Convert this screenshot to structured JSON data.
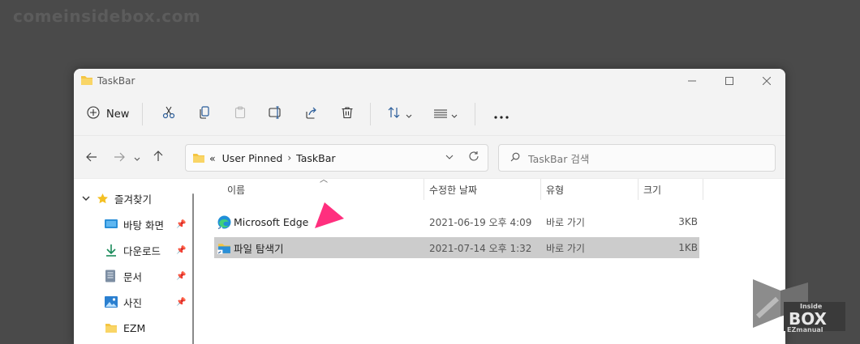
{
  "watermark": "comeinsidebox.com",
  "window": {
    "title": "TaskBar",
    "controls": {
      "minimize": "—",
      "maximize": "☐",
      "close": "✕"
    }
  },
  "toolbar": {
    "new_label": "New",
    "icons": [
      "cut-icon",
      "copy-icon",
      "paste-icon",
      "rename-icon",
      "share-icon",
      "delete-icon",
      "sort-icon",
      "view-icon",
      "more-icon"
    ]
  },
  "nav": {
    "back": "←",
    "forward": "→",
    "recent": "˅",
    "up": "↑",
    "address_prefix": "«",
    "breadcrumb": [
      "User Pinned",
      "TaskBar"
    ],
    "search_placeholder": "TaskBar 검색"
  },
  "sidebar": {
    "items": [
      {
        "label": "즐겨찾기",
        "icon": "star-icon",
        "pinned": false
      },
      {
        "label": "바탕 화면",
        "icon": "desktop-icon",
        "pinned": true
      },
      {
        "label": "다운로드",
        "icon": "download-icon",
        "pinned": true
      },
      {
        "label": "문서",
        "icon": "document-icon",
        "pinned": true
      },
      {
        "label": "사진",
        "icon": "pictures-icon",
        "pinned": true
      },
      {
        "label": "EZM",
        "icon": "folder-icon",
        "pinned": false
      }
    ]
  },
  "columns": {
    "name": "이름",
    "modified": "수정한 날짜",
    "type": "유형",
    "size": "크기"
  },
  "files": [
    {
      "name": "Microsoft Edge",
      "modified": "2021-06-19 오후 4:09",
      "type": "바로 가기",
      "size": "3KB",
      "icon": "edge-icon",
      "selected": false
    },
    {
      "name": "파일 탐색기",
      "modified": "2021-07-14 오후 1:32",
      "type": "바로 가기",
      "size": "1KB",
      "icon": "file-explorer-icon",
      "selected": true
    }
  ],
  "logo": {
    "line1": "Inside",
    "line2": "BOX",
    "line3": "EZmanual"
  },
  "colors": {
    "accent_arrow": "#ff2f7e",
    "selection": "#cccccc",
    "folder": "#f4c542"
  }
}
